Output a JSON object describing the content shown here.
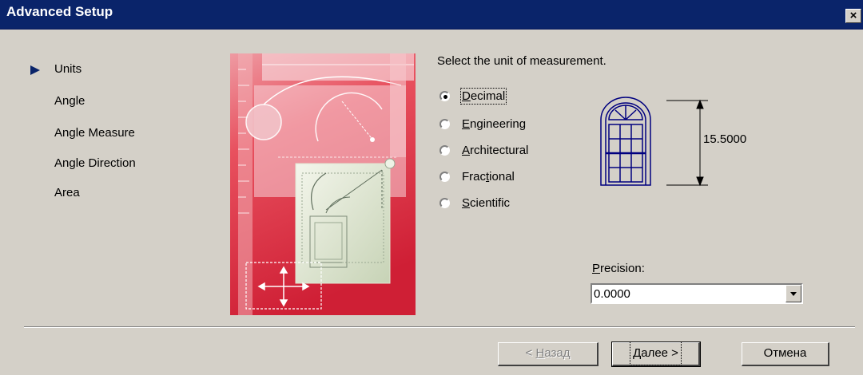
{
  "window": {
    "title": "Advanced Setup",
    "close_glyph": "×"
  },
  "nav": {
    "items": [
      {
        "label": "Units",
        "current": true
      },
      {
        "label": "Angle",
        "current": false
      },
      {
        "label": "Angle Measure",
        "current": false
      },
      {
        "label": "Angle Direction",
        "current": false
      },
      {
        "label": "Area",
        "current": false
      }
    ]
  },
  "main": {
    "prompt": "Select the unit of measurement.",
    "options": [
      {
        "pre": "",
        "key": "D",
        "post": "ecimal",
        "selected": true
      },
      {
        "pre": "",
        "key": "E",
        "post": "ngineering",
        "selected": false
      },
      {
        "pre": "",
        "key": "A",
        "post": "rchitectural",
        "selected": false
      },
      {
        "pre": "Frac",
        "key": "t",
        "post": "ional",
        "selected": false
      },
      {
        "pre": "",
        "key": "S",
        "post": "cientific",
        "selected": false
      }
    ],
    "preview_dimension": "15.5000",
    "precision": {
      "label_key": "P",
      "label_rest": "recision:",
      "value": "0.0000"
    }
  },
  "buttons": {
    "back": {
      "pre": "< ",
      "key": "Н",
      "post": "азад",
      "enabled": false
    },
    "next": {
      "label": "Далее >",
      "enabled": true
    },
    "cancel": {
      "label": "Отмена",
      "enabled": true
    }
  },
  "colors": {
    "title_bar": "#0a246a",
    "dialog_bg": "#d4d0c8",
    "illustration_red": "#d9283c",
    "drawing_blue": "#00007f"
  },
  "icons": {
    "nav_current": "triangle-right-icon",
    "close": "close-icon",
    "dropdown": "chevron-down-icon"
  }
}
